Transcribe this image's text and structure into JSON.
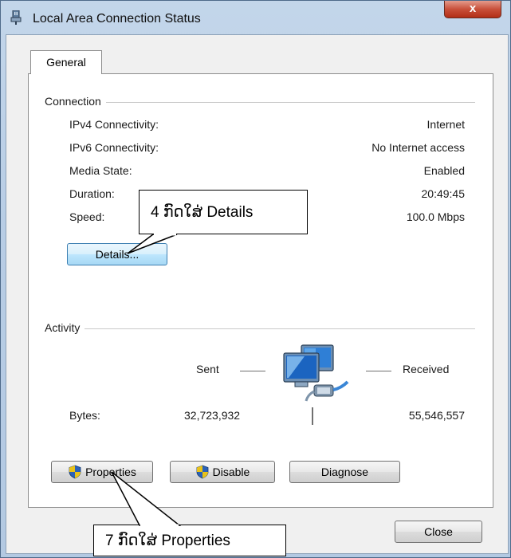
{
  "window": {
    "title": "Local Area Connection Status",
    "close_glyph": "x"
  },
  "tabs": [
    {
      "label": "General"
    }
  ],
  "connection": {
    "title": "Connection",
    "rows": [
      {
        "label": "IPv4 Connectivity:",
        "value": "Internet"
      },
      {
        "label": "IPv6 Connectivity:",
        "value": "No Internet access"
      },
      {
        "label": "Media State:",
        "value": "Enabled"
      },
      {
        "label": "Duration:",
        "value": "20:49:45"
      },
      {
        "label": "Speed:",
        "value": "100.0 Mbps"
      }
    ],
    "details_button": "Details..."
  },
  "activity": {
    "title": "Activity",
    "sent_label": "Sent",
    "received_label": "Received",
    "bytes_label": "Bytes:",
    "bytes_sent": "32,723,932",
    "bytes_received": "55,546,557"
  },
  "buttons": {
    "properties": "Properties",
    "disable": "Disable",
    "diagnose": "Diagnose",
    "close": "Close"
  },
  "callouts": {
    "details": "4 ກົດໃສ່ Details",
    "properties": "7 ກົດໃສ່ Properties"
  },
  "icons": {
    "window_icon": "network-adapter-icon",
    "activity_icon": "network-computers-icon",
    "uac_icon": "uac-shield-icon"
  }
}
